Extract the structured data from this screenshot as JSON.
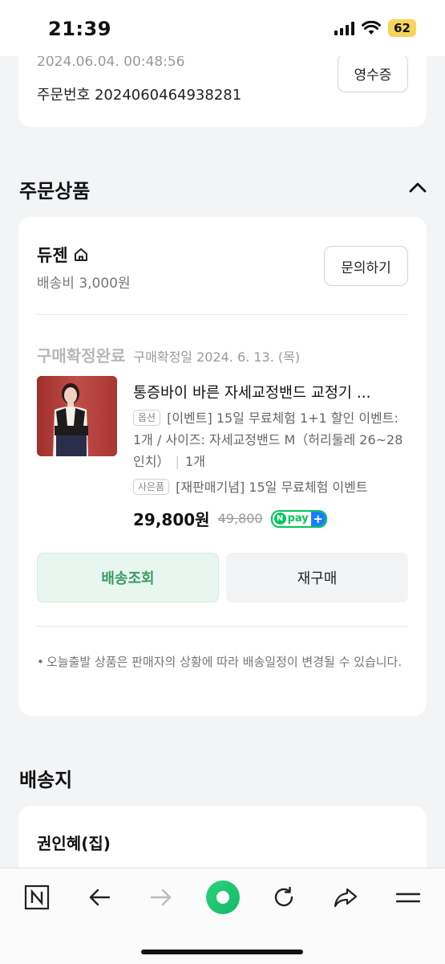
{
  "status_bar": {
    "time": "21:39",
    "battery": "62"
  },
  "order_info": {
    "datetime": "2024.06.04. 00:48:56",
    "order_number_label": "주문번호 2024060464938281",
    "receipt_button": "영수증"
  },
  "ordered_products": {
    "section_title": "주문상품",
    "seller": {
      "name": "듀젠",
      "shipping_fee": "배송비 3,000원",
      "inquiry_button": "문의하기"
    },
    "status": {
      "label": "구매확정완료",
      "confirm_date": "구매확정일 2024. 6. 13. (목)"
    },
    "product": {
      "title": "통증바이 바른 자세교정밴드 교정기 ...",
      "option_tag": "옵션",
      "option_text": "[이벤트] 15일 무료체험 1+1 할인 이벤트: 1개 / 사이즈: 자세교정밴드 M（허리둘레 26~28인치）",
      "quantity": "1개",
      "gift_tag": "사은품",
      "gift_text": "[재판매기념] 15일 무료체험 이벤트",
      "price": "29,800원",
      "original_price": "49,800",
      "npay_label": "pay"
    },
    "buttons": {
      "track": "배송조회",
      "rebuy": "재구매"
    },
    "notice": "오늘출발 상품은 판매자의 상황에 따라 배송일정이 변경될 수 있습니다."
  },
  "shipping_address": {
    "section_title": "배송지",
    "recipient": "권인혜(집)"
  },
  "colors": {
    "accent_green": "#03c75a",
    "track_text": "#3a9b62",
    "background": "#f3f4f6"
  },
  "bottom_nav": [
    "n-logo-icon",
    "back-arrow-icon",
    "forward-arrow-icon",
    "home-green-icon",
    "refresh-icon",
    "share-icon",
    "menu-icon"
  ]
}
